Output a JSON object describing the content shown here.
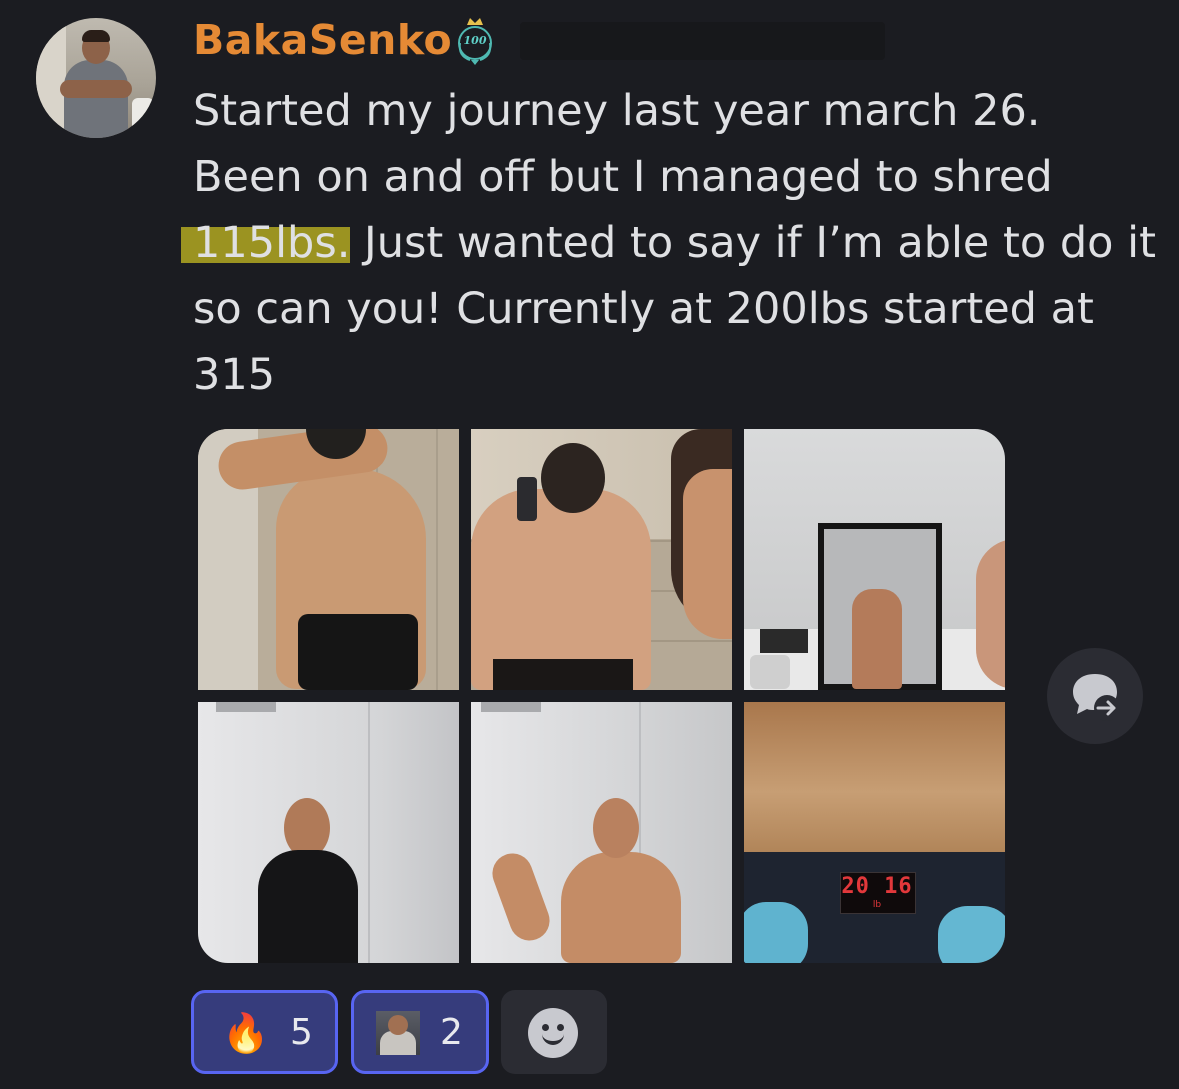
{
  "message": {
    "author": "BakaSenko",
    "badge_text": "100",
    "content_lines": [
      "Started my journey last year march 26.",
      "Been on and off but I managed to shred",
      "115lbs.",
      " Just wanted to say if I’m able to do it",
      "so can you! Currently at 200lbs started at",
      "315"
    ],
    "highlight_color": "#9b9321",
    "author_color": "#e58a35"
  },
  "attachments": [
    {
      "icon": "photo",
      "description_label": ""
    },
    {
      "icon": "photo",
      "description_label": ""
    },
    {
      "icon": "photo",
      "description_label": ""
    },
    {
      "icon": "photo",
      "description_label": ""
    },
    {
      "icon": "photo",
      "description_label": ""
    },
    {
      "icon": "photo",
      "description_label": ""
    }
  ],
  "scale_display": {
    "reading": "20 16",
    "unit": "lb"
  },
  "reactions": [
    {
      "emoji": "🔥",
      "count": "5",
      "selected": true
    },
    {
      "emoji": "custom-avatar-emoji",
      "count": "2",
      "selected": true
    }
  ],
  "add_reaction_icon": "smiley-add-icon",
  "thread_icon": "thread-reply-icon",
  "colors": {
    "background": "#1b1c21",
    "reaction_selected_bg": "#363c7c",
    "reaction_selected_border": "#5865f2",
    "text": "#dfe0e3"
  }
}
